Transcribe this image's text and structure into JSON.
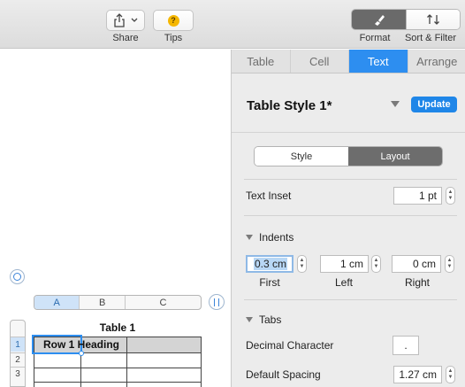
{
  "toolbar": {
    "share_label": "Share",
    "tips_label": "Tips",
    "format_label": "Format",
    "sort_filter_label": "Sort & Filter"
  },
  "inspector": {
    "tabs": [
      "Table",
      "Cell",
      "Text",
      "Arrange"
    ],
    "active_tab": "Text",
    "style_name": "Table Style 1*",
    "update_label": "Update",
    "segments": [
      "Style",
      "Layout"
    ],
    "active_segment": "Layout",
    "text_inset_label": "Text Inset",
    "text_inset_value": "1 pt",
    "indents_label": "Indents",
    "indent_first_value": "0.3 cm",
    "indent_left_value": "1 cm",
    "indent_right_value": "0 cm",
    "indent_first_label": "First",
    "indent_left_label": "Left",
    "indent_right_label": "Right",
    "tabs_label": "Tabs",
    "decimal_character_label": "Decimal Character",
    "decimal_character_value": ".",
    "default_spacing_label": "Default Spacing",
    "default_spacing_value": "1.27 cm"
  },
  "table": {
    "title": "Table 1",
    "columns": [
      "A",
      "B",
      "C"
    ],
    "rows": [
      "1",
      "2",
      "3"
    ],
    "cell_a1": "Row 1 Heading"
  },
  "colors": {
    "accent": "#2d8ef0",
    "update_button": "#1f86e8",
    "tips_icon": "#f5b700"
  }
}
